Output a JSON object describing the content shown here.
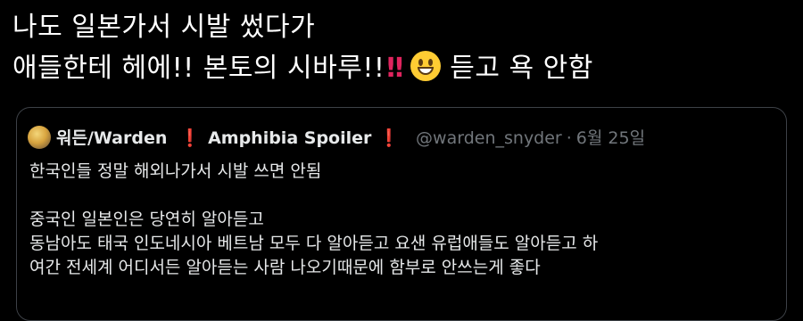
{
  "tweet": {
    "line1": "나도 일본가서 시발 썼다가",
    "line2_part1": "애들한테 헤에!! 본토의 시바루!!",
    "line2_part2": "듣고 욕 안함",
    "emoji_bang": "‼",
    "emoji_smile": "grinning-face-emoji"
  },
  "quote": {
    "display_name": "워든/Warden",
    "bang_glyph": "❗",
    "suffix_name": "Amphibia Spoiler",
    "handle": "@warden_snyder",
    "separator": "·",
    "date": "6월 25일",
    "lines": [
      "한국인들 정말 해외나가서 시발 쓰면 안됨",
      "중국인 일본인은 당연히 알아듣고",
      "동남아도 태국 인도네시아 베트남 모두 다 알아듣고 요샌 유럽애들도 알아듣고 하",
      "여간 전세계 어디서든 알아듣는 사람 나오기때문에 함부로 안쓰는게 좋다"
    ]
  },
  "colors": {
    "background": "#000000",
    "text": "#ffffff",
    "muted": "#71767b",
    "accent_red": "#e0245e",
    "border": "#3d4147"
  }
}
